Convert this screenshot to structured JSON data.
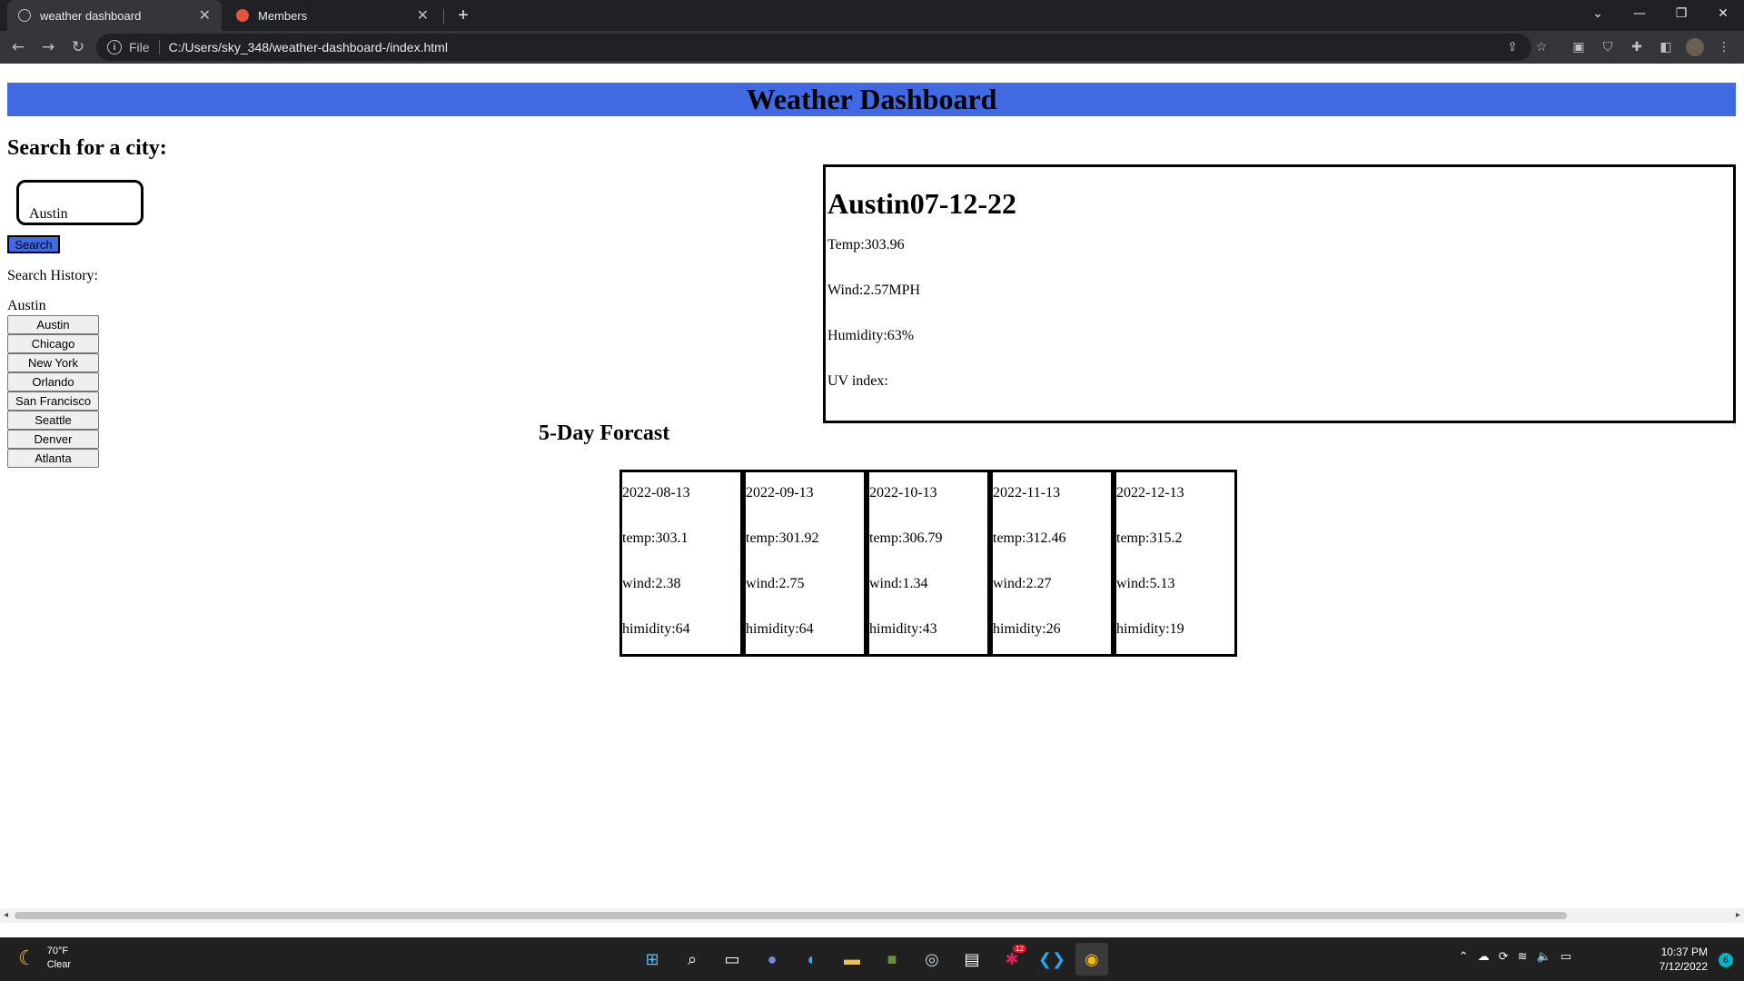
{
  "browser": {
    "tabs": [
      {
        "title": "weather dashboard",
        "active": true,
        "favicon": "globe-icon"
      },
      {
        "title": "Members",
        "active": false,
        "favicon": "circle-icon"
      }
    ],
    "url_scheme": "File",
    "url": "C:/Users/sky_348/weather-dashboard-/index.html"
  },
  "page": {
    "header_title": "Weather Dashboard",
    "search_heading": "Search for a city:",
    "search_input_value": "Austin",
    "search_button": "Search",
    "history_label": "Search History:",
    "history_current": "Austin",
    "history": [
      "Austin",
      "Chicago",
      "New York",
      "Orlando",
      "San Francisco",
      "Seattle",
      "Denver",
      "Atlanta"
    ],
    "current": {
      "title": "Austin07-12-22",
      "temp": "Temp:303.96",
      "wind": "Wind:2.57MPH",
      "humidity": "Humidity:63%",
      "uv": "UV index:"
    },
    "forecast_heading": "5-Day Forcast",
    "forecast": [
      {
        "date": "2022-08-13",
        "temp": "temp:303.1",
        "wind": "wind:2.38",
        "humidity": "himidity:64"
      },
      {
        "date": "2022-09-13",
        "temp": "temp:301.92",
        "wind": "wind:2.75",
        "humidity": "himidity:64"
      },
      {
        "date": "2022-10-13",
        "temp": "temp:306.79",
        "wind": "wind:1.34",
        "humidity": "himidity:43"
      },
      {
        "date": "2022-11-13",
        "temp": "temp:312.46",
        "wind": "wind:2.27",
        "humidity": "himidity:26"
      },
      {
        "date": "2022-12-13",
        "temp": "temp:315.2",
        "wind": "wind:5.13",
        "humidity": "himidity:19"
      }
    ]
  },
  "taskbar": {
    "weather_temp": "70°F",
    "weather_desc": "Clear",
    "time": "10:37 PM",
    "date": "7/12/2022",
    "notification_count": "6",
    "badge_count": "12"
  },
  "colors": {
    "header_bg": "#4169e1",
    "search_button_bg": "#4169e1"
  }
}
